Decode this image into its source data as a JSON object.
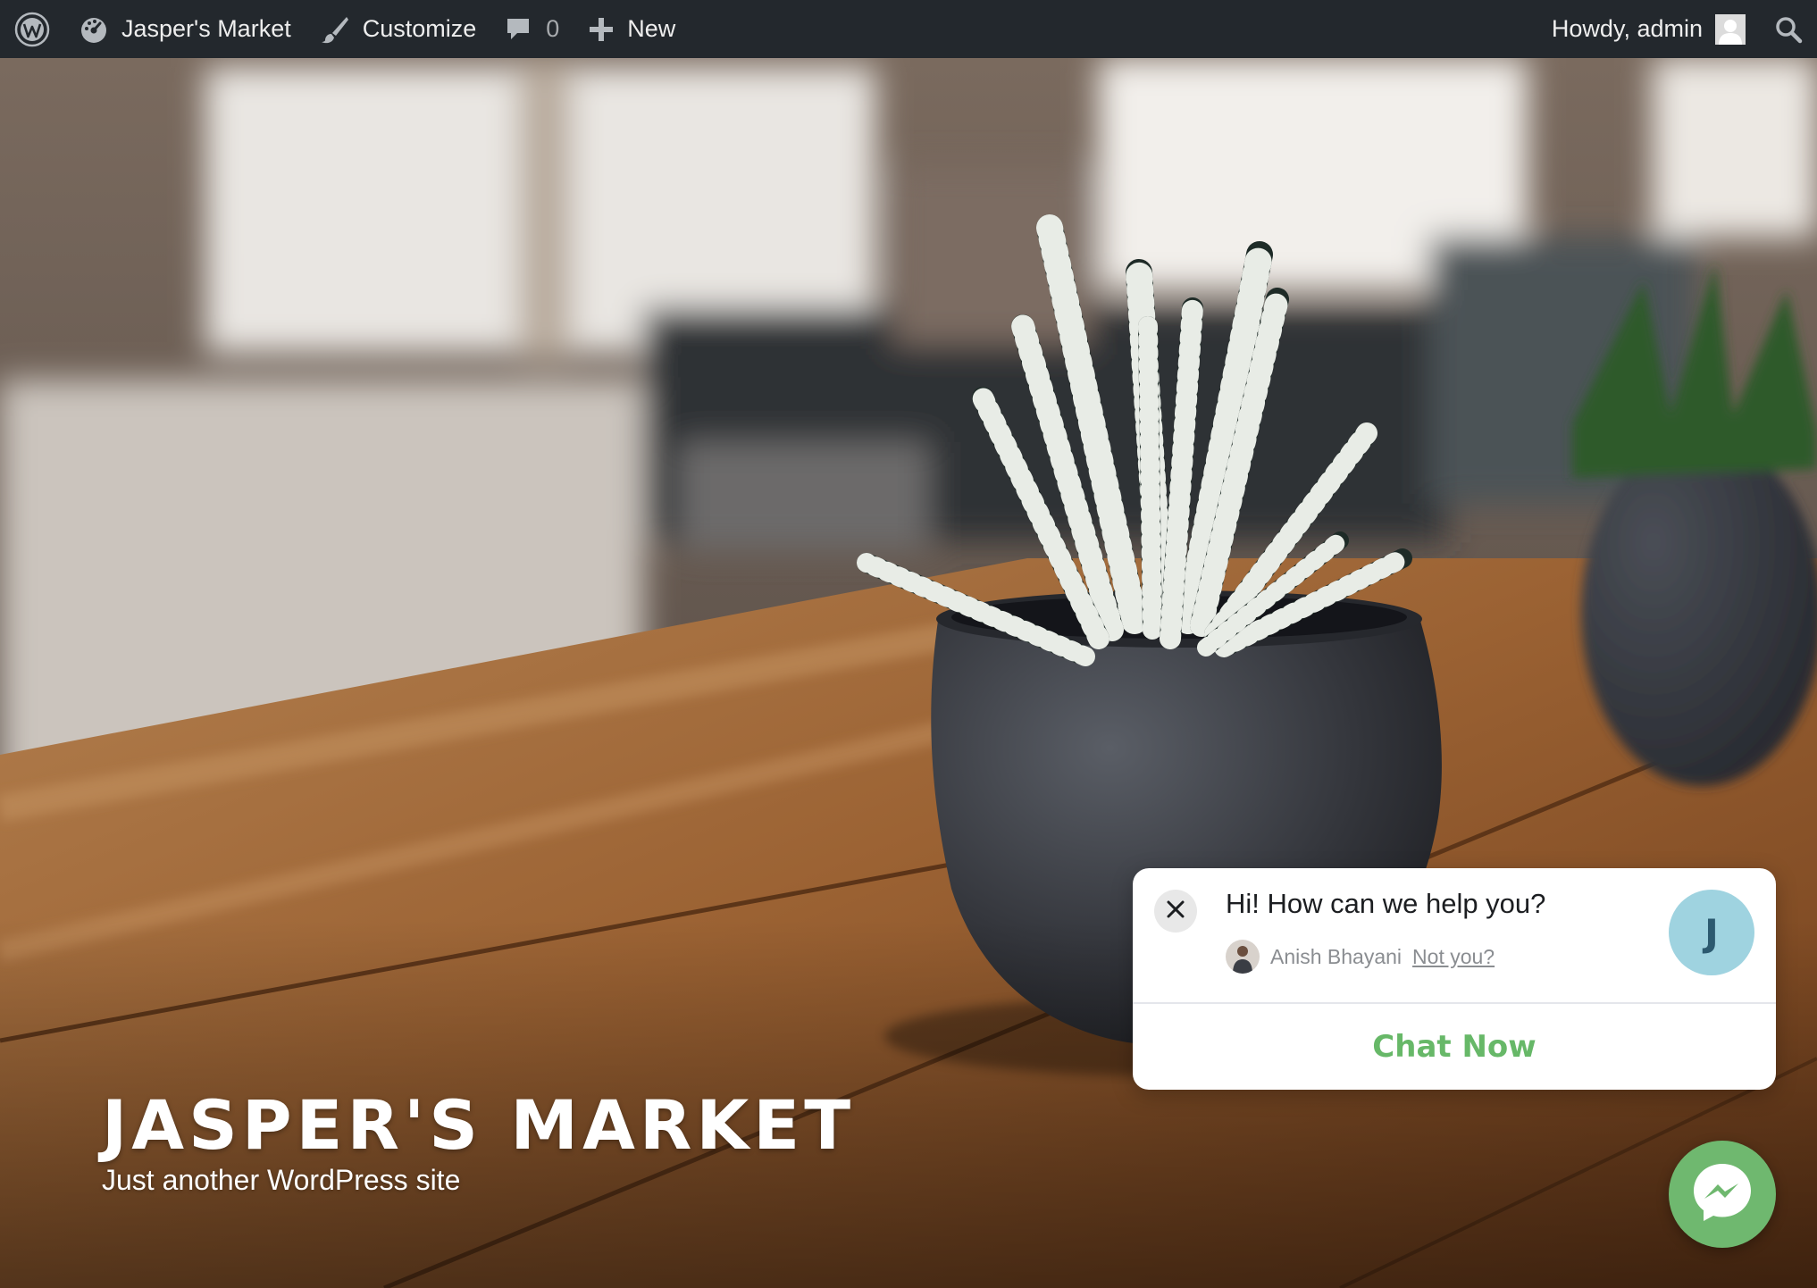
{
  "adminbar": {
    "site_name": "Jasper's Market",
    "customize_label": "Customize",
    "comments_count": "0",
    "new_label": "New",
    "howdy_label": "Howdy, admin",
    "icons": [
      "wordpress-logo-icon",
      "dashboard-icon",
      "brush-icon",
      "comment-icon",
      "plus-icon",
      "user-avatar-icon",
      "search-icon"
    ]
  },
  "hero": {
    "site_title": "JASPER'S MARKET",
    "tagline": "Just another WordPress site"
  },
  "chat_popup": {
    "greeting": "Hi! How can we help you?",
    "user_name": "Anish Bhayani",
    "not_you_link": "Not you?",
    "page_avatar_letter": "J",
    "cta_label": "Chat Now",
    "colors": {
      "cta": "#67b868",
      "page_avatar_bg": "#9fd3e0"
    }
  },
  "messenger_button": {
    "icon": "messenger-icon",
    "color": "#6fb86f"
  },
  "colors": {
    "adminbar_bg": "#23282d",
    "adminbar_text": "#eeeeee"
  }
}
